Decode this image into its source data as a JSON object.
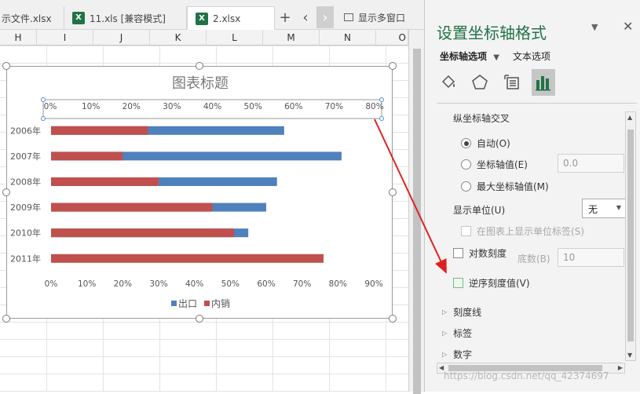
{
  "tabs": [
    {
      "label": "示文件.xlsx",
      "icon": "none",
      "active": false
    },
    {
      "label": "11.xls  [兼容模式]",
      "icon": "excel-icon",
      "active": false
    },
    {
      "label": "2.xlsx",
      "icon": "excel-icon",
      "active": true
    }
  ],
  "tab_actions": {
    "add": "+",
    "prev": "‹",
    "next": "›",
    "show_multiple": "显示多窗口"
  },
  "columns": [
    "H",
    "I",
    "J",
    "K",
    "L",
    "M",
    "N",
    "O"
  ],
  "colors": {
    "export": "#4f81bd",
    "domestic": "#c0504d",
    "accent": "#217346",
    "arrow": "#e02020"
  },
  "chart": {
    "title": "图表标题",
    "top_axis_ticks": [
      "0%",
      "10%",
      "20%",
      "30%",
      "40%",
      "50%",
      "60%",
      "70%",
      "80%"
    ],
    "bottom_axis_ticks": [
      "0%",
      "10%",
      "20%",
      "30%",
      "40%",
      "50%",
      "60%",
      "70%",
      "80%",
      "90%"
    ],
    "legend": [
      "出口",
      "内销"
    ]
  },
  "chart_data": {
    "type": "bar",
    "orientation": "horizontal",
    "stacked": false,
    "title": "图表标题",
    "categories": [
      "2006年",
      "2007年",
      "2008年",
      "2009年",
      "2010年",
      "2011年"
    ],
    "series": [
      {
        "name": "出口",
        "values": [
          0.65,
          0.81,
          0.63,
          0.6,
          0.55,
          0.0
        ]
      },
      {
        "name": "内销",
        "values": [
          0.27,
          0.2,
          0.3,
          0.45,
          0.51,
          0.76
        ]
      }
    ],
    "xlim": [
      0,
      0.9
    ],
    "top_axis_range": [
      0,
      0.8
    ],
    "legend_position": "bottom"
  },
  "panel": {
    "title": "设置坐标轴格式",
    "collapse": "▼",
    "close": "✕",
    "tab_axis": "坐标轴选项",
    "tab_axis_arrow": "▼",
    "tab_text": "文本选项",
    "icons": [
      "fill-bucket-icon",
      "pentagon-icon",
      "size-properties-icon",
      "bar-chart-icon"
    ],
    "section": "纵坐标轴交叉",
    "radio_auto": "自动(O)",
    "radio_axis_value": "坐标轴值(E)",
    "axis_value": "0.0",
    "radio_max": "最大坐标轴值(M)",
    "display_unit_label": "显示单位(U)",
    "display_unit_value": "无",
    "show_unit_label": "在图表上显示单位标签(S)",
    "log_scale": "对数刻度",
    "log_base_label": "底数(B)",
    "log_base_value": "10",
    "reverse": "逆序刻度值(V)",
    "expanders": [
      "刻度线",
      "标签",
      "数字"
    ]
  },
  "watermark": "https://blog.csdn.net/qq_42374697"
}
